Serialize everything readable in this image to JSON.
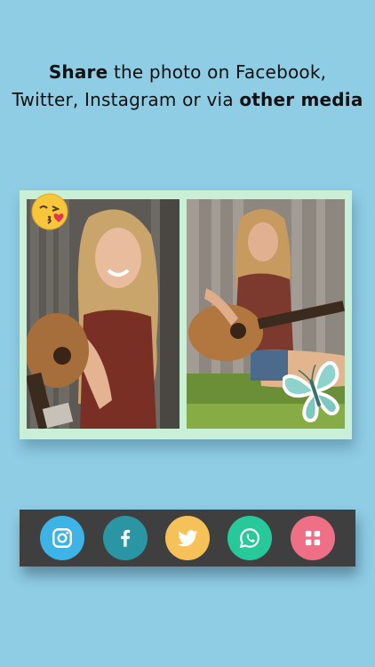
{
  "headline": {
    "line1": {
      "bold": "Share",
      "rest": " the photo on Facebook,"
    },
    "line2": {
      "rest": "Twitter, Instagram or via ",
      "bold": "other media"
    }
  },
  "collage": {
    "stickers": [
      "kiss-emoji-icon",
      "butterfly-icon"
    ]
  },
  "share_buttons": [
    {
      "name": "instagram",
      "icon": "instagram-icon",
      "color": "#3eb3e6"
    },
    {
      "name": "facebook",
      "icon": "facebook-icon",
      "color": "#2b96a3"
    },
    {
      "name": "twitter",
      "icon": "twitter-icon",
      "color": "#f7c15a"
    },
    {
      "name": "whatsapp",
      "icon": "whatsapp-icon",
      "color": "#27c99b"
    },
    {
      "name": "more",
      "icon": "grid-icon",
      "color": "#ef6f86"
    }
  ],
  "colors": {
    "background": "#8fcde5",
    "share_bar": "#3f3f3f",
    "collage_frame": "#c9f0d6"
  }
}
